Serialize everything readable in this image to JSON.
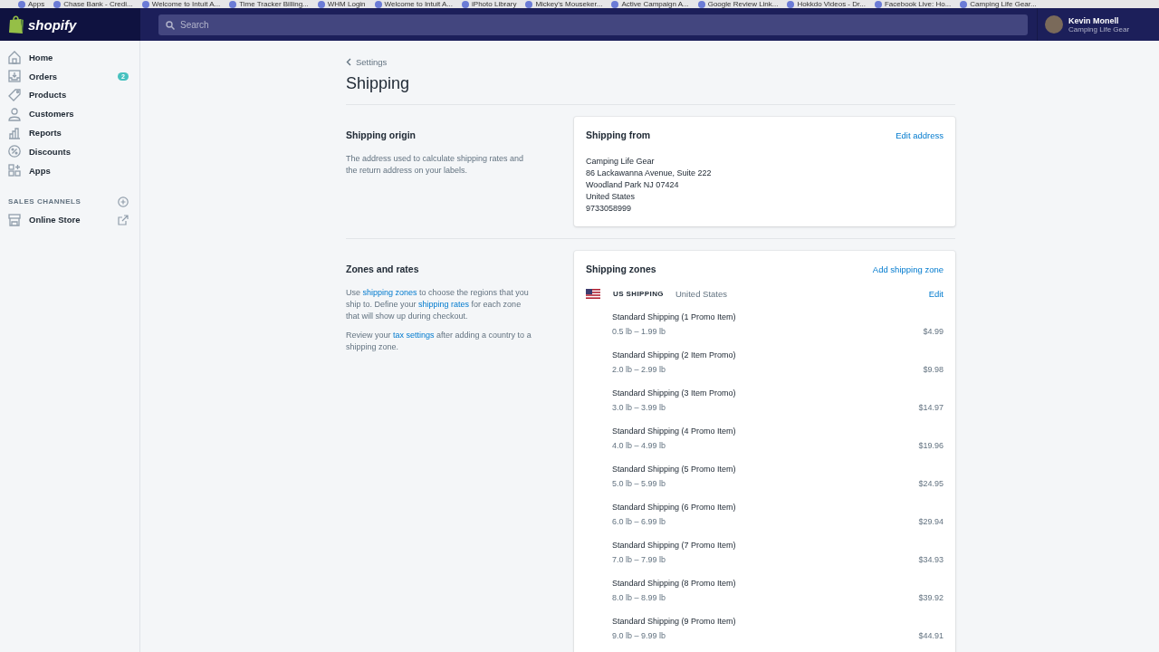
{
  "bookmarks": [
    "Apps",
    "Chase Bank - Credi...",
    "Welcome to Intuit A...",
    "Time Tracker Billing...",
    "WHM Login",
    "Welcome to Intuit A...",
    "iPhoto Library",
    "Mickey's Mouseker...",
    "Active Campaign A...",
    "Google Review Link...",
    "Hokkdo Videos - Dr...",
    "Facebook Live: Ho...",
    "Camping Life Gear..."
  ],
  "topbar": {
    "logo": "shopify",
    "search": {
      "placeholder": "Search"
    },
    "user": {
      "name": "Kevin Monell",
      "store": "Camping Life Gear"
    }
  },
  "sidebar": {
    "items": [
      {
        "label": "Home",
        "selected": false
      },
      {
        "label": "Orders",
        "badge": "2",
        "selected": false
      },
      {
        "label": "Products",
        "selected": false
      },
      {
        "label": "Customers",
        "selected": false
      },
      {
        "label": "Reports",
        "selected": false
      },
      {
        "label": "Discounts",
        "selected": false
      },
      {
        "label": "Apps",
        "selected": false
      }
    ],
    "section": {
      "title": "SALES CHANNELS",
      "items": [
        {
          "label": "Online Store",
          "selected": false
        }
      ]
    }
  },
  "breadcrumb": "Settings",
  "title": "Shipping",
  "sections": [
    {
      "title": "Shipping origin",
      "description": [
        [
          {
            "text": "The address used to calculate shipping rates and the return address on your labels."
          }
        ]
      ],
      "card": {
        "kind": "address",
        "title": "Shipping from",
        "action": "Edit address",
        "lines": [
          "Camping Life Gear",
          "86 Lackawanna Avenue, Suite 222",
          "Woodland Park NJ 07424",
          "United States",
          "9733058999"
        ]
      }
    },
    {
      "title": "Zones and rates",
      "description": [
        [
          {
            "text": "Use "
          },
          {
            "text": "shipping zones",
            "link": true
          },
          {
            "text": " to choose the regions that you ship to. Define your "
          },
          {
            "text": "shipping rates",
            "link": true
          },
          {
            "text": " for each zone that will show up during checkout."
          }
        ],
        [
          {
            "text": "Review your "
          },
          {
            "text": "tax settings",
            "link": true
          },
          {
            "text": " after adding a country to a shipping zone."
          }
        ]
      ],
      "card": {
        "kind": "zones",
        "title": "Shipping zones",
        "action": "Add shipping zone",
        "zone": {
          "name": "US SHIPPING",
          "country": "United States",
          "action": "Edit"
        },
        "rates": [
          {
            "name": "Standard Shipping (1 Promo Item)",
            "range": "0.5 lb – 1.99 lb",
            "price": "$4.99"
          },
          {
            "name": "Standard Shipping (2 Item Promo)",
            "range": "2.0 lb – 2.99 lb",
            "price": "$9.98"
          },
          {
            "name": "Standard Shipping (3 Item Promo)",
            "range": "3.0 lb – 3.99 lb",
            "price": "$14.97"
          },
          {
            "name": "Standard Shipping (4 Promo Item)",
            "range": "4.0 lb – 4.99 lb",
            "price": "$19.96"
          },
          {
            "name": "Standard Shipping (5 Promo Item)",
            "range": "5.0 lb – 5.99 lb",
            "price": "$24.95"
          },
          {
            "name": "Standard Shipping (6 Promo Item)",
            "range": "6.0 lb – 6.99 lb",
            "price": "$29.94"
          },
          {
            "name": "Standard Shipping (7 Promo Item)",
            "range": "7.0 lb – 7.99 lb",
            "price": "$34.93"
          },
          {
            "name": "Standard Shipping (8 Promo Item)",
            "range": "8.0 lb – 8.99 lb",
            "price": "$39.92"
          },
          {
            "name": "Standard Shipping (9 Promo Item)",
            "range": "9.0 lb – 9.99 lb",
            "price": "$44.91"
          }
        ]
      }
    }
  ]
}
